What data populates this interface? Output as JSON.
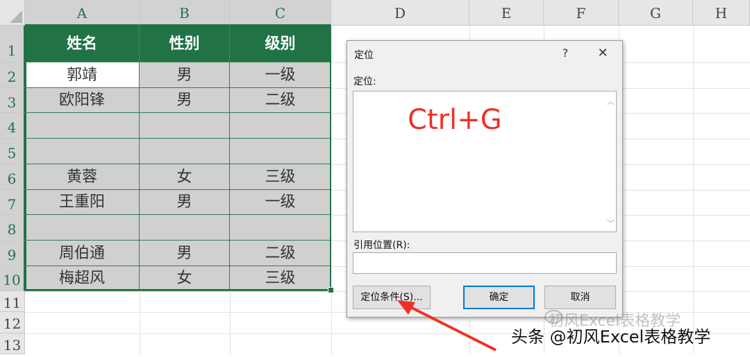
{
  "spreadsheet": {
    "columns": [
      "A",
      "B",
      "C",
      "D",
      "E",
      "F",
      "G",
      "H"
    ],
    "rows": [
      "1",
      "2",
      "3",
      "4",
      "5",
      "6",
      "7",
      "8",
      "9",
      "10",
      "11",
      "12",
      "13"
    ],
    "header": [
      "姓名",
      "性别",
      "级别"
    ],
    "data": [
      [
        "郭靖",
        "男",
        "一级"
      ],
      [
        "欧阳锋",
        "男",
        "二级"
      ],
      [
        "",
        "",
        ""
      ],
      [
        "",
        "",
        ""
      ],
      [
        "黄蓉",
        "女",
        "三级"
      ],
      [
        "王重阳",
        "男",
        "一级"
      ],
      [
        "",
        "",
        ""
      ],
      [
        "周伯通",
        "男",
        "二级"
      ],
      [
        "梅超风",
        "女",
        "三级"
      ]
    ],
    "header_fill": "#217346",
    "selection_fill": "#d0d0d0"
  },
  "dialog": {
    "title": "定位",
    "help_glyph": "?",
    "close_glyph": "✕",
    "goto_label": "定位:",
    "overlay_text": "Ctrl+G",
    "reference_label": "引用位置(R):",
    "reference_value": "",
    "special_button": "定位条件(S)...",
    "ok_button": "确定",
    "cancel_button": "取消"
  },
  "watermark": {
    "faint": "初风Excel表格教学",
    "main": "头条 @初风Excel表格教学"
  },
  "colors": {
    "accent_green": "#217346",
    "annotation_red": "#ee3124"
  }
}
